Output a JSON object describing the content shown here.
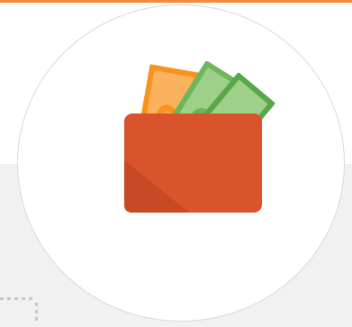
{
  "colors": {
    "accent_bar": "#f08a3c",
    "background_band": "#f1f1f1",
    "circle_border": "#d9d9d9",
    "wallet": "#d9532b",
    "wallet_shadow": "#c74a24",
    "bill_orange": "#f7941d",
    "bill_orange_light": "#fbb25f",
    "bill_green": "#6db65b",
    "bill_green_light": "#9ed08a",
    "bill_green_dark": "#5aa64a",
    "dotted_marks": "#c8c8c8"
  },
  "icons": {
    "wallet": "wallet-icon",
    "bills": "banknote-icon",
    "coin": "dollar-coin-icon"
  }
}
